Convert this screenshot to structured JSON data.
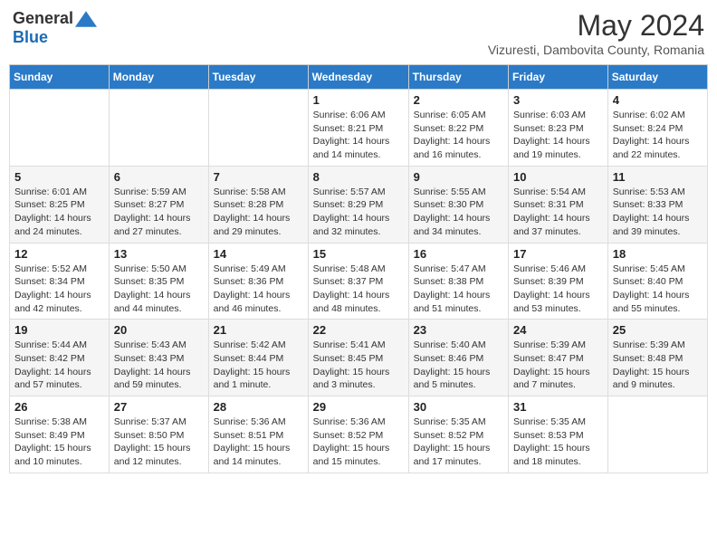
{
  "logo": {
    "general": "General",
    "blue": "Blue"
  },
  "title": {
    "month_year": "May 2024",
    "location": "Vizuresti, Dambovita County, Romania"
  },
  "days_of_week": [
    "Sunday",
    "Monday",
    "Tuesday",
    "Wednesday",
    "Thursday",
    "Friday",
    "Saturday"
  ],
  "weeks": [
    [
      {
        "day": "",
        "info": ""
      },
      {
        "day": "",
        "info": ""
      },
      {
        "day": "",
        "info": ""
      },
      {
        "day": "1",
        "info": "Sunrise: 6:06 AM\nSunset: 8:21 PM\nDaylight: 14 hours and 14 minutes."
      },
      {
        "day": "2",
        "info": "Sunrise: 6:05 AM\nSunset: 8:22 PM\nDaylight: 14 hours and 16 minutes."
      },
      {
        "day": "3",
        "info": "Sunrise: 6:03 AM\nSunset: 8:23 PM\nDaylight: 14 hours and 19 minutes."
      },
      {
        "day": "4",
        "info": "Sunrise: 6:02 AM\nSunset: 8:24 PM\nDaylight: 14 hours and 22 minutes."
      }
    ],
    [
      {
        "day": "5",
        "info": "Sunrise: 6:01 AM\nSunset: 8:25 PM\nDaylight: 14 hours and 24 minutes."
      },
      {
        "day": "6",
        "info": "Sunrise: 5:59 AM\nSunset: 8:27 PM\nDaylight: 14 hours and 27 minutes."
      },
      {
        "day": "7",
        "info": "Sunrise: 5:58 AM\nSunset: 8:28 PM\nDaylight: 14 hours and 29 minutes."
      },
      {
        "day": "8",
        "info": "Sunrise: 5:57 AM\nSunset: 8:29 PM\nDaylight: 14 hours and 32 minutes."
      },
      {
        "day": "9",
        "info": "Sunrise: 5:55 AM\nSunset: 8:30 PM\nDaylight: 14 hours and 34 minutes."
      },
      {
        "day": "10",
        "info": "Sunrise: 5:54 AM\nSunset: 8:31 PM\nDaylight: 14 hours and 37 minutes."
      },
      {
        "day": "11",
        "info": "Sunrise: 5:53 AM\nSunset: 8:33 PM\nDaylight: 14 hours and 39 minutes."
      }
    ],
    [
      {
        "day": "12",
        "info": "Sunrise: 5:52 AM\nSunset: 8:34 PM\nDaylight: 14 hours and 42 minutes."
      },
      {
        "day": "13",
        "info": "Sunrise: 5:50 AM\nSunset: 8:35 PM\nDaylight: 14 hours and 44 minutes."
      },
      {
        "day": "14",
        "info": "Sunrise: 5:49 AM\nSunset: 8:36 PM\nDaylight: 14 hours and 46 minutes."
      },
      {
        "day": "15",
        "info": "Sunrise: 5:48 AM\nSunset: 8:37 PM\nDaylight: 14 hours and 48 minutes."
      },
      {
        "day": "16",
        "info": "Sunrise: 5:47 AM\nSunset: 8:38 PM\nDaylight: 14 hours and 51 minutes."
      },
      {
        "day": "17",
        "info": "Sunrise: 5:46 AM\nSunset: 8:39 PM\nDaylight: 14 hours and 53 minutes."
      },
      {
        "day": "18",
        "info": "Sunrise: 5:45 AM\nSunset: 8:40 PM\nDaylight: 14 hours and 55 minutes."
      }
    ],
    [
      {
        "day": "19",
        "info": "Sunrise: 5:44 AM\nSunset: 8:42 PM\nDaylight: 14 hours and 57 minutes."
      },
      {
        "day": "20",
        "info": "Sunrise: 5:43 AM\nSunset: 8:43 PM\nDaylight: 14 hours and 59 minutes."
      },
      {
        "day": "21",
        "info": "Sunrise: 5:42 AM\nSunset: 8:44 PM\nDaylight: 15 hours and 1 minute."
      },
      {
        "day": "22",
        "info": "Sunrise: 5:41 AM\nSunset: 8:45 PM\nDaylight: 15 hours and 3 minutes."
      },
      {
        "day": "23",
        "info": "Sunrise: 5:40 AM\nSunset: 8:46 PM\nDaylight: 15 hours and 5 minutes."
      },
      {
        "day": "24",
        "info": "Sunrise: 5:39 AM\nSunset: 8:47 PM\nDaylight: 15 hours and 7 minutes."
      },
      {
        "day": "25",
        "info": "Sunrise: 5:39 AM\nSunset: 8:48 PM\nDaylight: 15 hours and 9 minutes."
      }
    ],
    [
      {
        "day": "26",
        "info": "Sunrise: 5:38 AM\nSunset: 8:49 PM\nDaylight: 15 hours and 10 minutes."
      },
      {
        "day": "27",
        "info": "Sunrise: 5:37 AM\nSunset: 8:50 PM\nDaylight: 15 hours and 12 minutes."
      },
      {
        "day": "28",
        "info": "Sunrise: 5:36 AM\nSunset: 8:51 PM\nDaylight: 15 hours and 14 minutes."
      },
      {
        "day": "29",
        "info": "Sunrise: 5:36 AM\nSunset: 8:52 PM\nDaylight: 15 hours and 15 minutes."
      },
      {
        "day": "30",
        "info": "Sunrise: 5:35 AM\nSunset: 8:52 PM\nDaylight: 15 hours and 17 minutes."
      },
      {
        "day": "31",
        "info": "Sunrise: 5:35 AM\nSunset: 8:53 PM\nDaylight: 15 hours and 18 minutes."
      },
      {
        "day": "",
        "info": ""
      }
    ]
  ]
}
